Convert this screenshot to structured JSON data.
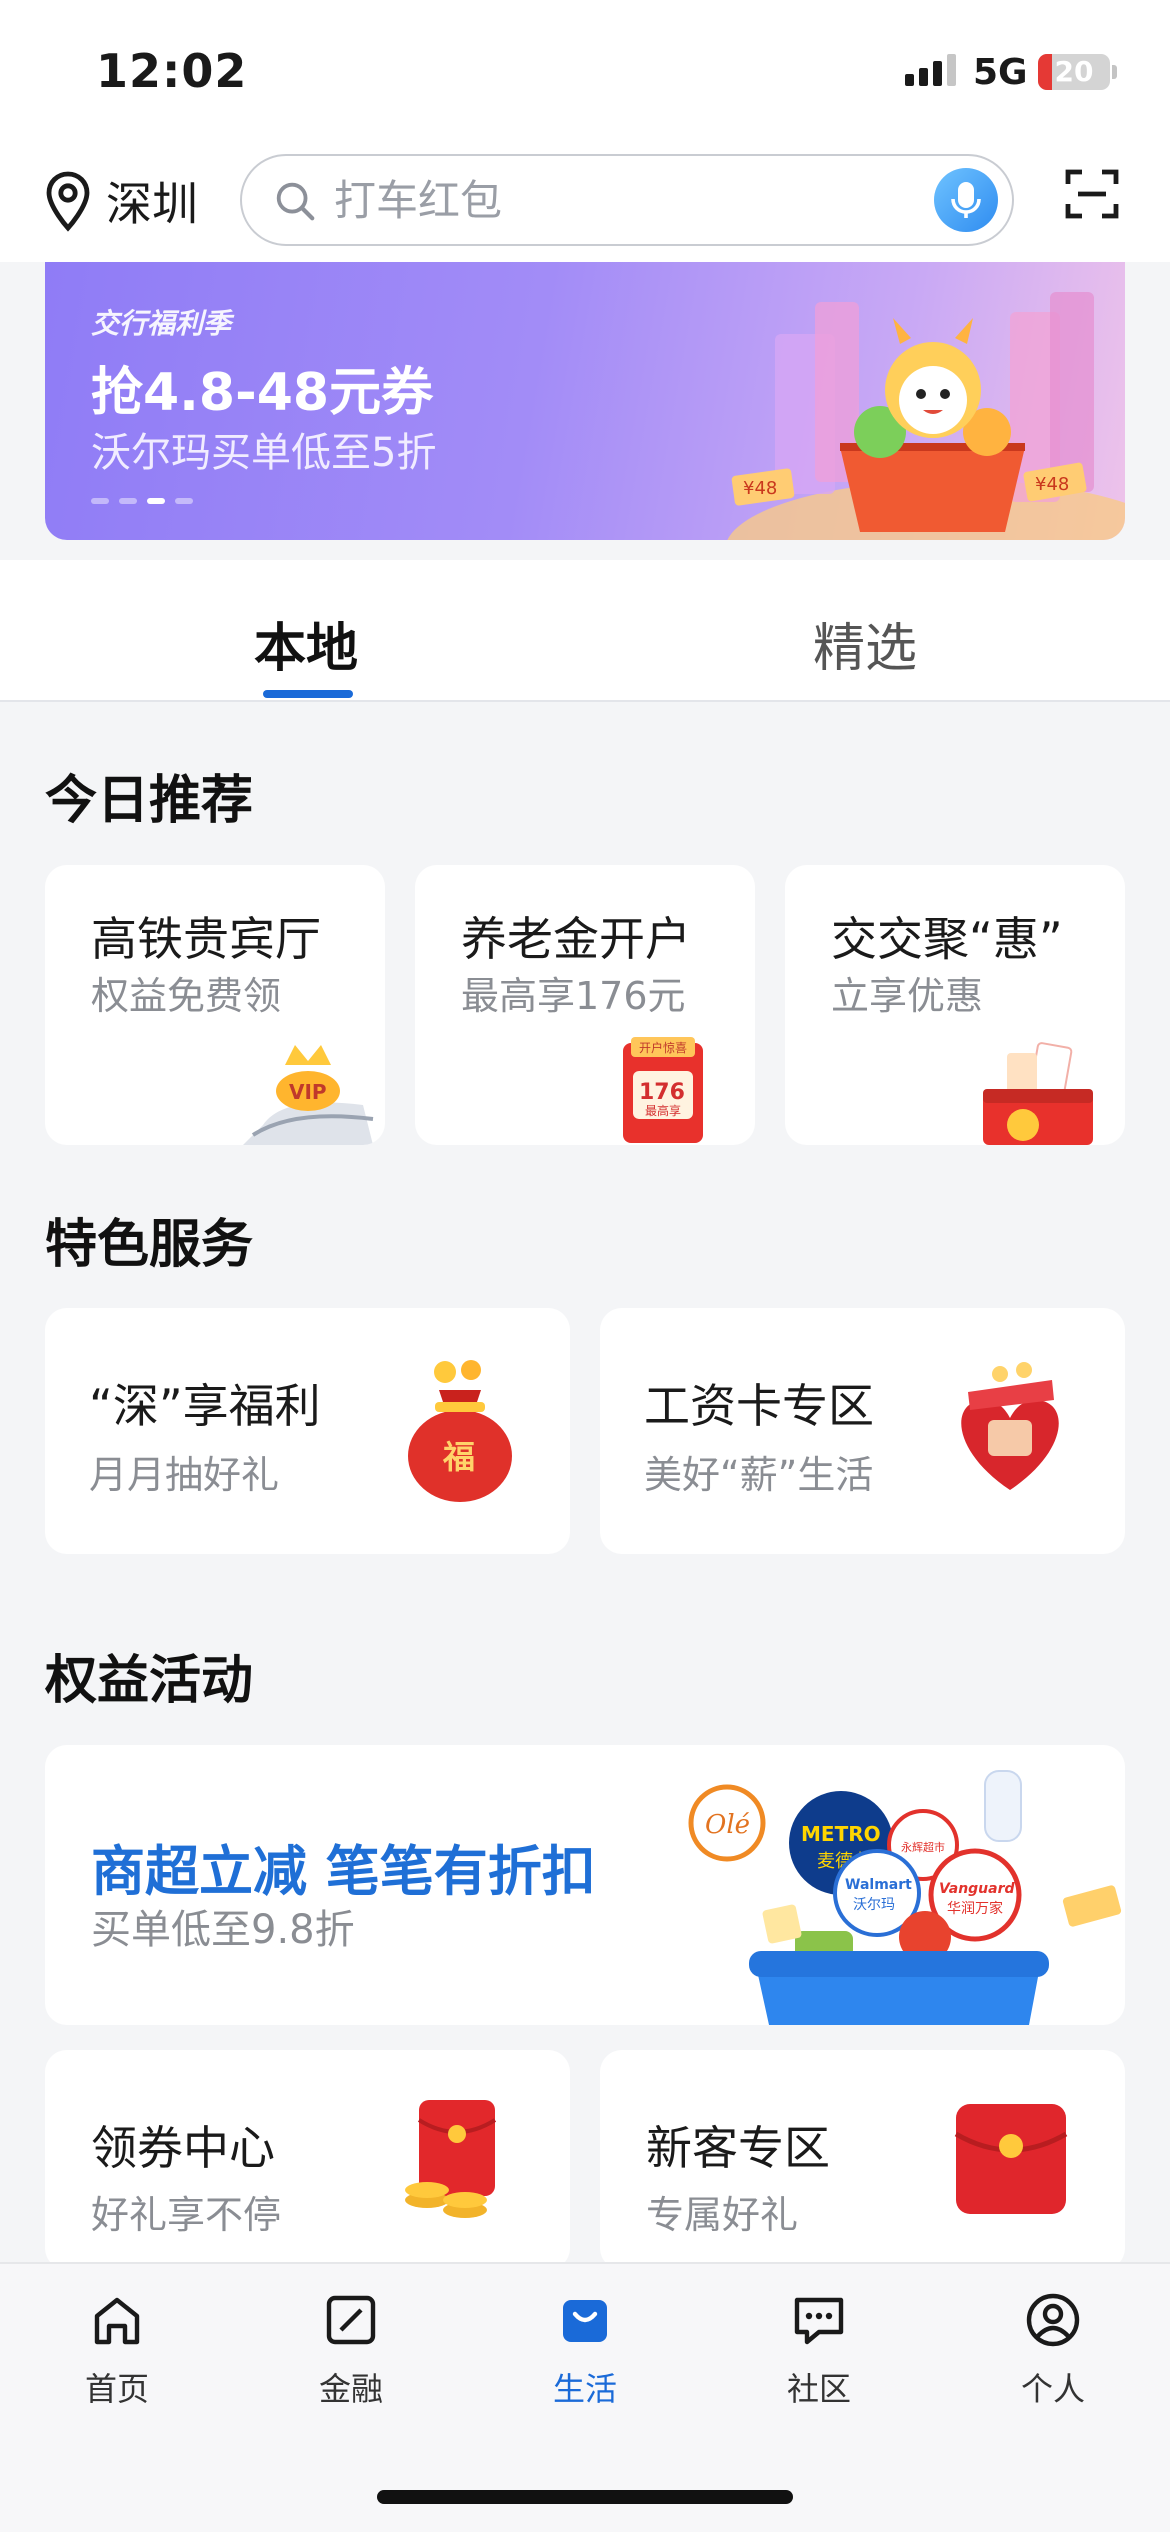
{
  "status_bar": {
    "time": "12:02",
    "network": "5G",
    "battery": "20",
    "battery_level": 0.2
  },
  "header": {
    "city": "深圳",
    "search_placeholder": "打车红包"
  },
  "banner": {
    "tag": "交行福利季",
    "title": "抢4.8-48元券",
    "subtitle": "沃尔玛买单低至5折",
    "slide_count": 4,
    "active_slide": 3,
    "coupon_labels": [
      "¥48",
      "¥48"
    ]
  },
  "tabs": [
    {
      "label": "本地",
      "active": true
    },
    {
      "label": "精选",
      "active": false
    }
  ],
  "today": {
    "title": "今日推荐",
    "cards": [
      {
        "title": "高铁贵宾厅",
        "subtitle": "权益免费领",
        "badge": "VIP"
      },
      {
        "title": "养老金开户",
        "subtitle": "最高享176元",
        "badge_top": "开户惊喜",
        "badge_num": "176",
        "badge_bottom": "最高享"
      },
      {
        "title": "交交聚“惠”",
        "subtitle": "立享优惠"
      }
    ]
  },
  "featured": {
    "title": "特色服务",
    "cards": [
      {
        "title": "“深”享福利",
        "subtitle": "月月抽好礼",
        "badge": "福"
      },
      {
        "title": "工资卡专区",
        "subtitle": "美好“薪”生活"
      }
    ]
  },
  "rights": {
    "title": "权益活动",
    "hero": {
      "title": "商超立减 笔笔有折扣",
      "subtitle": "买单低至9.8折",
      "brands": [
        "Olé",
        "METRO",
        "麦德龙",
        "Walmart",
        "沃尔玛",
        "Vanguard",
        "华润万家",
        "永辉超市"
      ]
    },
    "cards": [
      {
        "title": "领券中心",
        "subtitle": "好礼享不停"
      },
      {
        "title": "新客专区",
        "subtitle": "专属好礼"
      }
    ]
  },
  "nav": [
    {
      "label": "首页",
      "icon": "home-icon",
      "active": false
    },
    {
      "label": "金融",
      "icon": "finance-icon",
      "active": false
    },
    {
      "label": "生活",
      "icon": "shopping-bag-icon",
      "active": true
    },
    {
      "label": "社区",
      "icon": "chat-icon",
      "active": false
    },
    {
      "label": "个人",
      "icon": "profile-icon",
      "active": false
    }
  ],
  "colors": {
    "accent": "#1a6ad8",
    "banner": "#8f7cf6",
    "hero_title": "#1f6fd6",
    "battery_low": "#e53935"
  }
}
